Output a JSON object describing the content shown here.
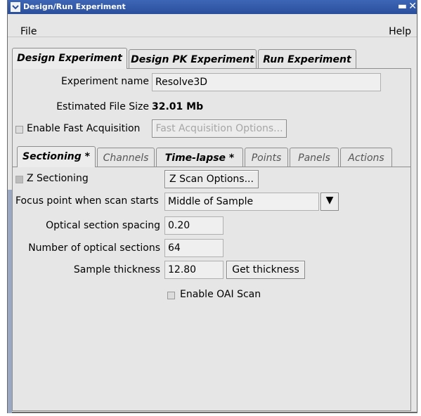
{
  "window": {
    "title": "Design/Run Experiment"
  },
  "menu": {
    "file": "File",
    "help": "Help"
  },
  "main_tabs": [
    {
      "label": "Design Experiment",
      "active": true
    },
    {
      "label": "Design PK Experiment",
      "active": false
    },
    {
      "label": "Run Experiment",
      "active": false
    }
  ],
  "design": {
    "experiment_name_label": "Experiment name",
    "experiment_name_value": "Resolve3D",
    "file_size_label": "Estimated File Size",
    "file_size_value": "32.01 Mb",
    "fast_acq_label": "Enable Fast Acquisition",
    "fast_acq_button": "Fast Acquisition Options..."
  },
  "sub_tabs": [
    {
      "label": "Sectioning *",
      "active": true,
      "bold": true
    },
    {
      "label": "Channels",
      "active": false,
      "bold": false
    },
    {
      "label": "Time-lapse *",
      "active": false,
      "bold": true
    },
    {
      "label": "Points",
      "active": false,
      "bold": false
    },
    {
      "label": "Panels",
      "active": false,
      "bold": false
    },
    {
      "label": "Actions",
      "active": false,
      "bold": false
    }
  ],
  "sectioning": {
    "z_section_label": "Z Sectioning",
    "z_scan_button": "Z Scan Options...",
    "focus_label": "Focus point when scan starts",
    "focus_value": "Middle of Sample",
    "spacing_label": "Optical section spacing",
    "spacing_value": "0.20",
    "num_sections_label": "Number of optical sections",
    "num_sections_value": "64",
    "thickness_label": "Sample thickness",
    "thickness_value": "12.80",
    "get_thickness_button": "Get thickness",
    "oai_label": "Enable OAI Scan"
  },
  "colors": {
    "titlebar": "#2f57a8",
    "window_bg": "#e6e6e6"
  }
}
